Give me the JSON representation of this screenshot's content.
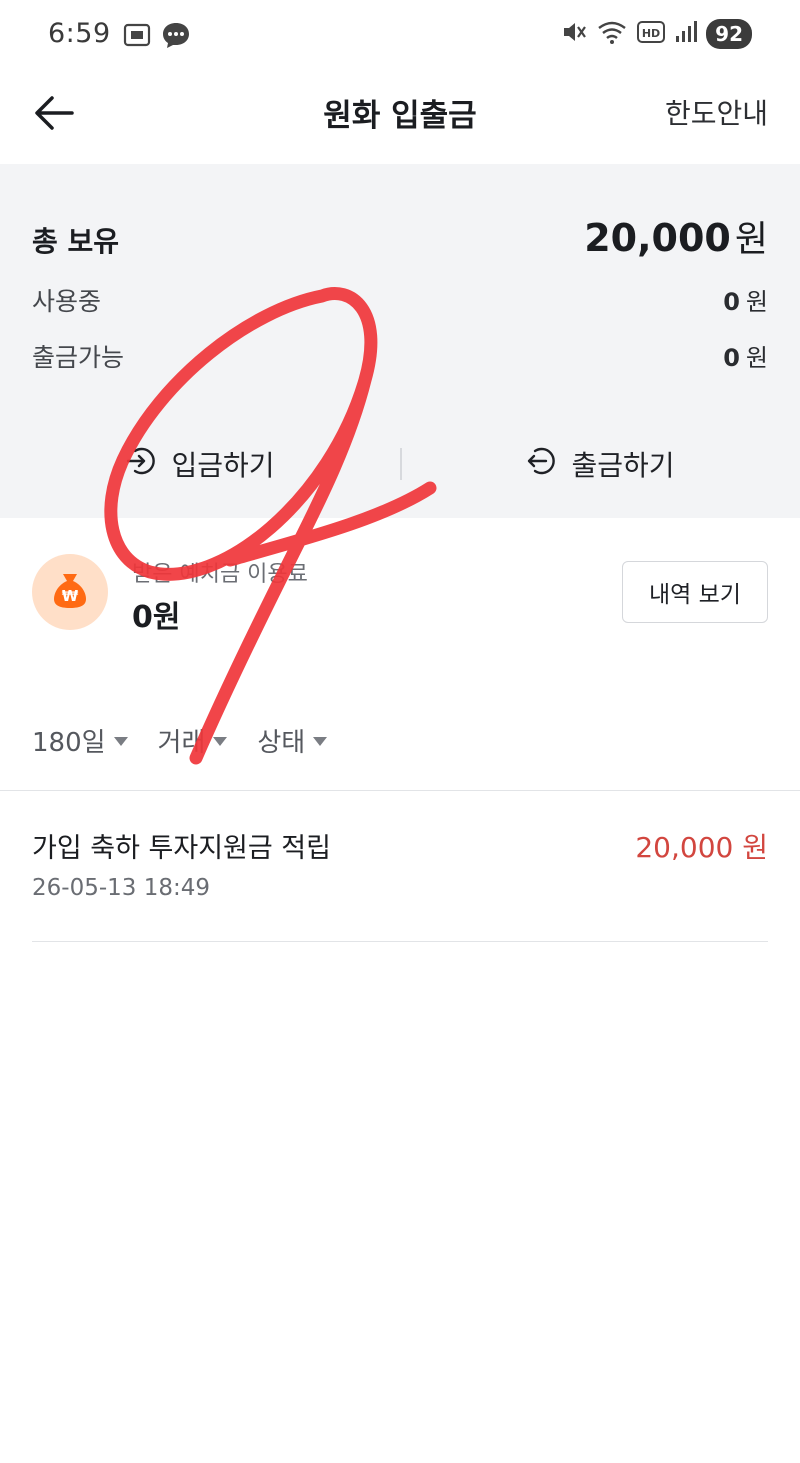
{
  "status_bar": {
    "time": "6:59",
    "battery": "92",
    "left_icons": [
      "screenshot-icon",
      "chat-bubble-icon"
    ],
    "right_icons": [
      "mute-icon",
      "wifi-icon",
      "hd-icon",
      "signal-icon"
    ]
  },
  "header": {
    "title": "원화 입출금",
    "limit_link": "한도안내",
    "back_icon": "back-arrow-icon"
  },
  "balance": {
    "total_label": "총 보유",
    "total_amount": "20,000",
    "total_unit": "원",
    "in_use_label": "사용중",
    "in_use_amount": "0",
    "in_use_unit": "원",
    "withdrawable_label": "출금가능",
    "withdrawable_amount": "0",
    "withdrawable_unit": "원"
  },
  "actions": {
    "deposit_label": "입금하기",
    "withdraw_label": "출금하기"
  },
  "fee": {
    "label": "받은 예치금 이용료",
    "amount": "0원",
    "history_button": "내역 보기",
    "icon": "money-bag-icon"
  },
  "filters": [
    {
      "label": "180일"
    },
    {
      "label": "거래"
    },
    {
      "label": "상태"
    }
  ],
  "transactions": [
    {
      "title": "가입 축하 투자지원금 적립",
      "date": "26-05-13 18:49",
      "amount": "20,000 원"
    }
  ],
  "colors": {
    "panel_bg": "#f3f4f6",
    "credit_red": "#d2463f",
    "annotation_red": "#f0353a",
    "fee_icon_orange": "#ff6a13"
  }
}
